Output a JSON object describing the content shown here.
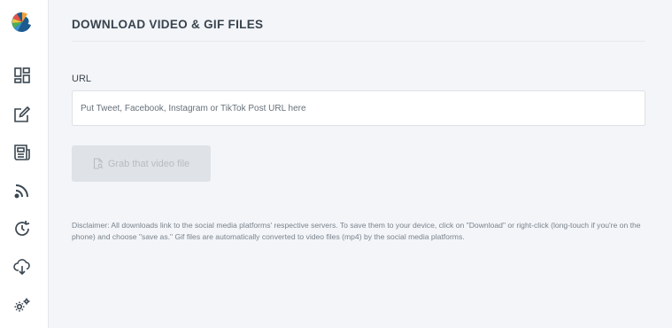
{
  "sidebar": {
    "icons": [
      "dashboard-icon",
      "edit-icon",
      "newspaper-icon",
      "rss-icon",
      "history-icon",
      "cloud-download-icon",
      "settings-icon"
    ]
  },
  "main": {
    "title": "DOWNLOAD VIDEO & GIF FILES",
    "url_label": "URL",
    "url_placeholder": "Put Tweet, Facebook, Instagram or TikTok Post URL here",
    "url_value": "",
    "grab_button_label": "Grab that video file",
    "disclaimer": "Disclaimer: All downloads link to the social media platforms' respective servers. To save them to your device, click on \"Download\" or right-click (long-touch if you're on the phone) and choose \"save as.\" Gif files are automatically converted to video files (mp4) by the social media platforms."
  },
  "colors": {
    "background": "#f3f5f9",
    "logo_blue": "#1d5b8f",
    "button_disabled": "#dfe2e6",
    "icon": "#3a4650"
  }
}
